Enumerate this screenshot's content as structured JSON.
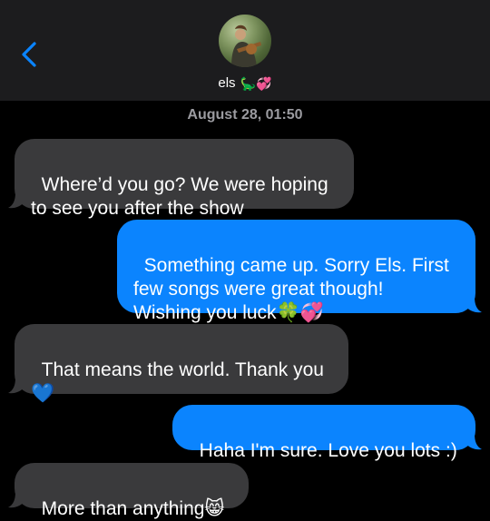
{
  "header": {
    "contact_name": "els",
    "contact_emoji": "🦕💞",
    "back_icon": "chevron-left-icon"
  },
  "thread": {
    "timestamp": "August 28, 01:50",
    "messages": [
      {
        "direction": "received",
        "text": "Where’d you go? We were hoping\nto see you after the show"
      },
      {
        "direction": "sent",
        "text": "Something came up. Sorry Els. First\nfew songs were great though!\nWishing you luck🍀💞"
      },
      {
        "direction": "received",
        "text": "That means the world. Thank you\n💙"
      },
      {
        "direction": "sent",
        "text": "Haha I'm sure. Love you lots :)"
      },
      {
        "direction": "received",
        "text": "More than anything😸"
      }
    ]
  },
  "colors": {
    "sent_bubble": "#0b84fe",
    "received_bubble": "#3a3a3c",
    "header_bg": "#1c1c1e",
    "accent": "#0a84ff"
  }
}
